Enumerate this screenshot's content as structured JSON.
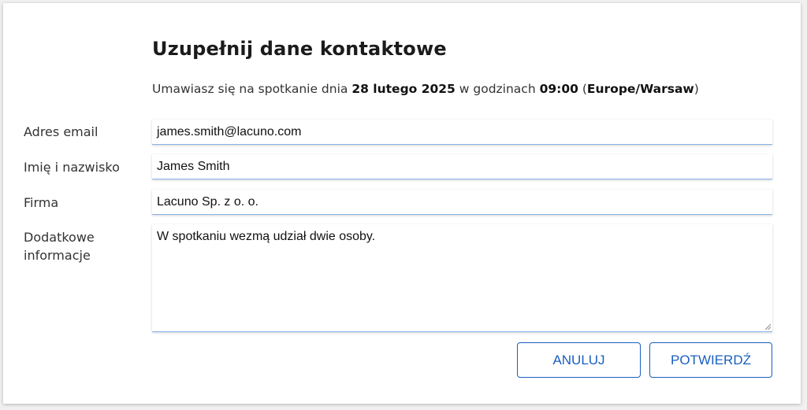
{
  "form": {
    "title": "Uzupełnij dane kontaktowe",
    "subtitle": {
      "prefix": "Umawiasz się na spotkanie dnia ",
      "date": "28 lutego 2025",
      "middle": " w godzinach ",
      "time": "09:00",
      "tz_open": " (",
      "timezone": "Europe/Warsaw",
      "tz_close": ")"
    },
    "fields": {
      "email": {
        "label": "Adres email",
        "value": "james.smith@lacuno.com"
      },
      "name": {
        "label": "Imię i nazwisko",
        "value": "James Smith"
      },
      "company": {
        "label": "Firma",
        "value": "Lacuno Sp. z o. o."
      },
      "notes": {
        "label_line1": "Dodatkowe",
        "label_line2": "informacje",
        "value": "W spotkaniu wezmą udział dwie osoby."
      }
    },
    "buttons": {
      "cancel": "ANULUJ",
      "confirm": "POTWIERDŹ"
    },
    "colors": {
      "accent": "#1a5fbf",
      "field_underline": "#8ab4e8"
    }
  }
}
